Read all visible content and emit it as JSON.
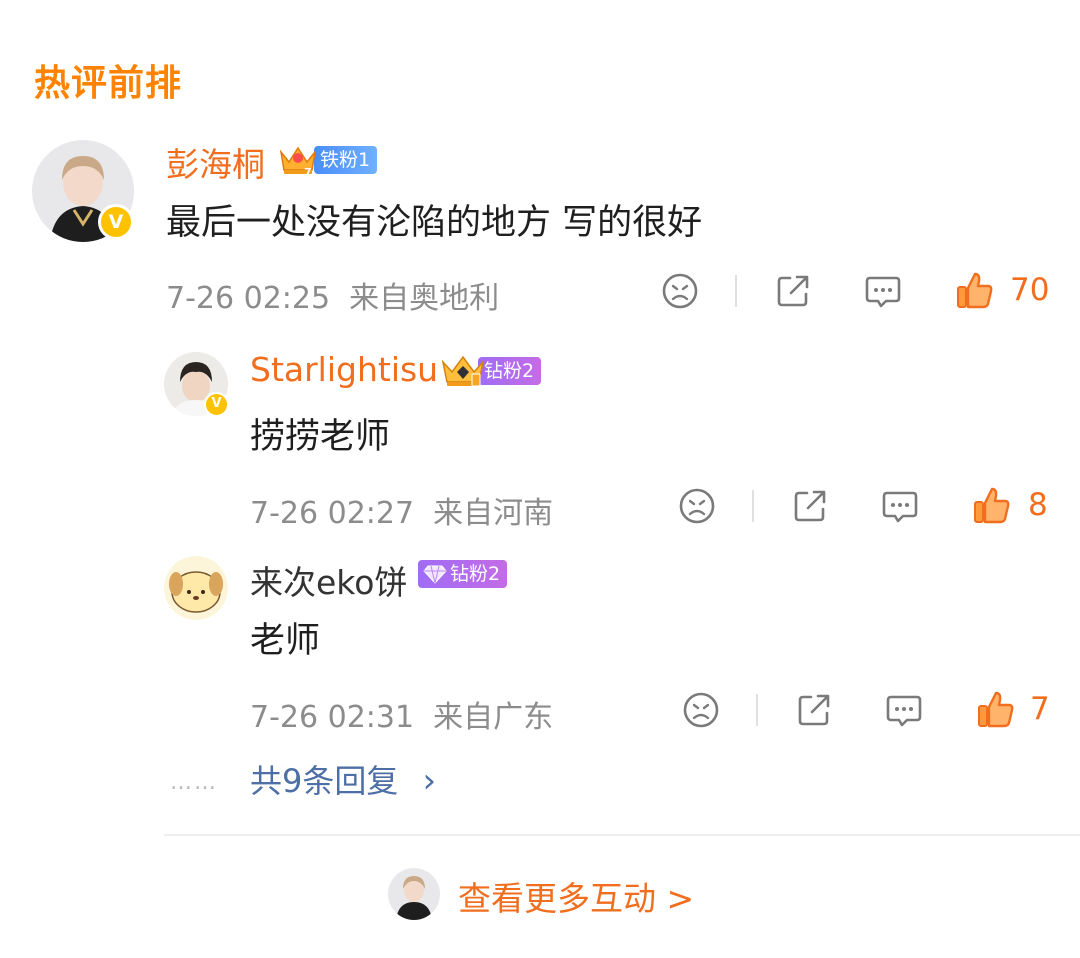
{
  "section_title": "热评前排",
  "colors": {
    "accent": "#ff8200",
    "username_orange": "#f06e1e",
    "link_blue": "#4d6fa6",
    "verified_yellow": "#ffc200"
  },
  "comments": [
    {
      "username": "彭海桐",
      "fan_badge": {
        "label": "铁粉1",
        "level_num": "7",
        "type": "iron"
      },
      "text": "最后一处没有沦陷的地方 写的很好",
      "time": "7-26 02:25",
      "location": "来自奥地利",
      "likes": "70",
      "verified": true
    },
    {
      "username": "Starlightisu",
      "fan_badge": {
        "label": "钻粉2",
        "type": "diamond"
      },
      "text": "捞捞老师",
      "time": "7-26 02:27",
      "location": "来自河南",
      "likes": "8",
      "verified": true
    },
    {
      "username": "来次eko饼",
      "fan_badge": {
        "label": "钻粉2",
        "type": "diamond"
      },
      "text": "老师",
      "time": "7-26 02:31",
      "location": "来自广东",
      "likes": "7",
      "verified": false
    }
  ],
  "replies_link": {
    "dots": "……",
    "label": "共9条回复",
    "chevron": "›"
  },
  "more_link": {
    "label": "查看更多互动 >"
  },
  "icons": [
    "dislike-face-icon",
    "share-icon",
    "comment-icon",
    "thumbs-up-icon",
    "verified-v-icon",
    "crown-icon",
    "diamond-icon"
  ]
}
